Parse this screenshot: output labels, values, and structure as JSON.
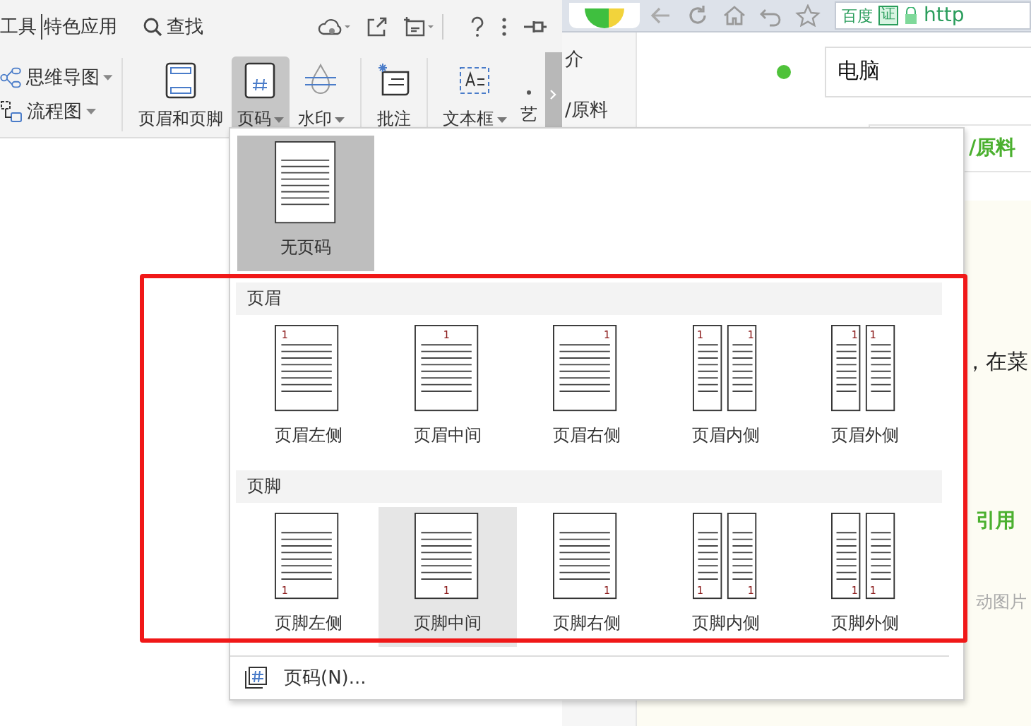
{
  "app": {
    "menu_tabs": [
      "工具",
      "特色应用"
    ],
    "search_label": "查找",
    "ribbon": {
      "small_buttons": [
        {
          "label": "思维导图",
          "kind": "mindmap"
        },
        {
          "label": "流程图",
          "kind": "flowchart"
        }
      ],
      "buttons": [
        {
          "label": "页眉和页脚",
          "kind": "header-footer",
          "dropdown": false,
          "selected": false
        },
        {
          "label": "页码",
          "kind": "page-number",
          "dropdown": true,
          "selected": true
        },
        {
          "label": "水印",
          "kind": "watermark",
          "dropdown": true,
          "selected": false
        },
        {
          "label": "批注",
          "kind": "comment",
          "dropdown": false,
          "selected": false
        },
        {
          "label": "文本框",
          "kind": "textbox",
          "dropdown": true,
          "selected": false
        },
        {
          "label": "艺",
          "kind": "art",
          "dropdown": false,
          "selected": false
        }
      ]
    }
  },
  "dropdown_menu": {
    "top_options": [
      {
        "label": "无页码",
        "kind": "none",
        "selected": true
      }
    ],
    "sections": [
      {
        "title": "页眉",
        "kind": "header",
        "options": [
          {
            "label": "页眉左侧",
            "kind": "left",
            "numbers": [
              "1"
            ],
            "selected": false,
            "hovered": false
          },
          {
            "label": "页眉中间",
            "kind": "center",
            "numbers": [
              "1"
            ],
            "selected": false,
            "hovered": false
          },
          {
            "label": "页眉右侧",
            "kind": "right",
            "numbers": [
              "1"
            ],
            "selected": false,
            "hovered": false
          },
          {
            "label": "页眉内侧",
            "kind": "inside",
            "numbers": [
              "1",
              "1"
            ],
            "selected": false,
            "hovered": false
          },
          {
            "label": "页眉外侧",
            "kind": "outside",
            "numbers": [
              "1",
              "1"
            ],
            "selected": false,
            "hovered": false
          }
        ]
      },
      {
        "title": "页脚",
        "kind": "footer",
        "options": [
          {
            "label": "页脚左侧",
            "kind": "left",
            "numbers": [
              "1"
            ],
            "selected": false,
            "hovered": false
          },
          {
            "label": "页脚中间",
            "kind": "center",
            "numbers": [
              "1"
            ],
            "selected": false,
            "hovered": true
          },
          {
            "label": "页脚右侧",
            "kind": "right",
            "numbers": [
              "1"
            ],
            "selected": false,
            "hovered": false
          },
          {
            "label": "页脚内侧",
            "kind": "inside",
            "numbers": [
              "1",
              "1"
            ],
            "selected": false,
            "hovered": false
          },
          {
            "label": "页脚外侧",
            "kind": "outside",
            "numbers": [
              "1",
              "1"
            ],
            "selected": false,
            "hovered": false
          }
        ]
      }
    ],
    "footer_item": {
      "label": "页码(N)..."
    }
  },
  "browser": {
    "badge": "百度",
    "verified": "证",
    "url": "http"
  },
  "page": {
    "sidebar_items": [
      "介",
      "/原料"
    ],
    "search_value": "电脑",
    "heading": "/原料",
    "body_text": "，在菜",
    "link_heading": "引用",
    "caption": "动图片"
  }
}
